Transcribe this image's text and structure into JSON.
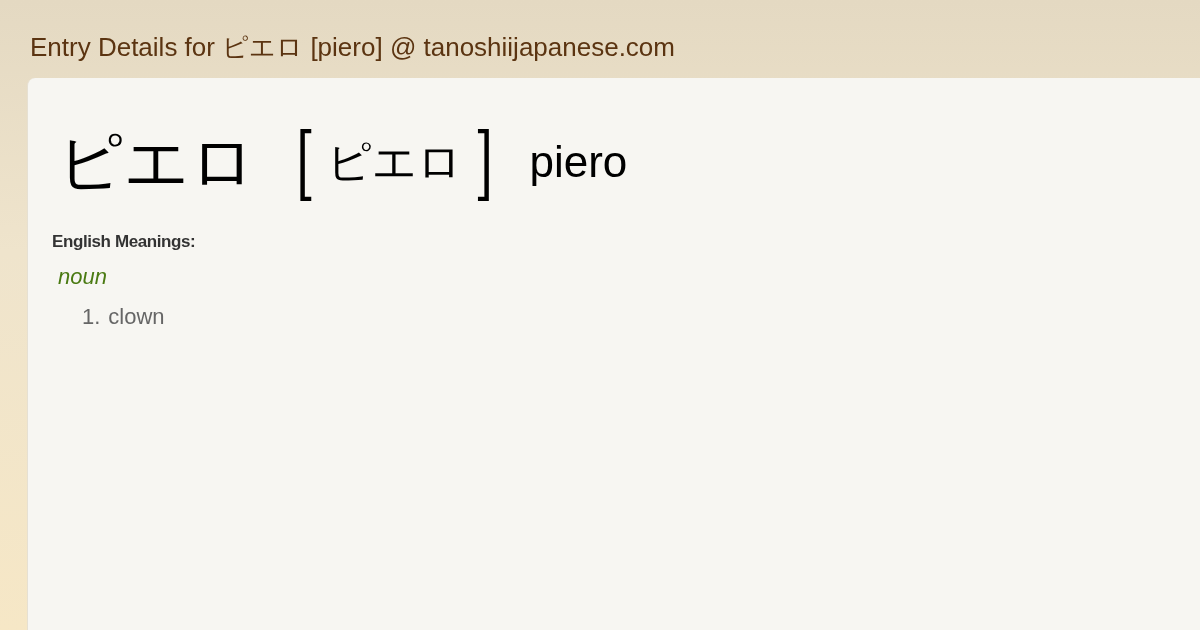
{
  "page_title": "Entry Details for ピエロ [piero] @ tanoshiijapanese.com",
  "entry": {
    "word": "ピエロ",
    "bracket_left": "[",
    "reading": "ピエロ",
    "bracket_right": "]",
    "romaji": "piero"
  },
  "meanings_label": "English Meanings:",
  "senses": [
    {
      "pos": "noun",
      "definitions": [
        {
          "number": "1.",
          "text": "clown"
        }
      ]
    }
  ]
}
